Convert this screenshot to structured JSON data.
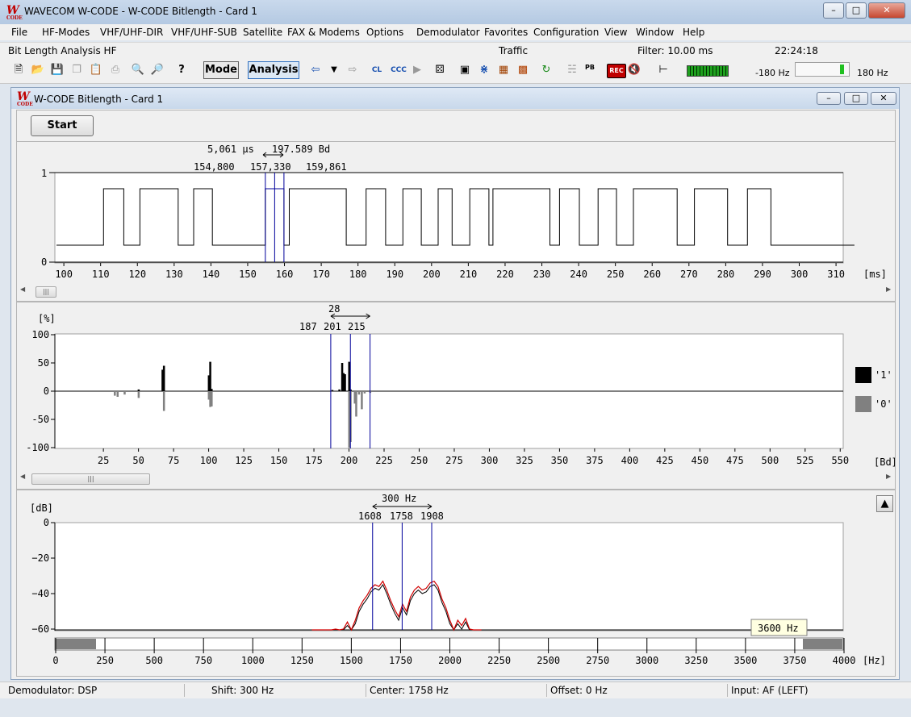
{
  "window": {
    "title": "WAVECOM W-CODE - W-CODE Bitlength  - Card 1"
  },
  "menu": [
    "File",
    "HF-Modes",
    "VHF/UHF-DIR",
    "VHF/UHF-SUB",
    "Satellite",
    "FAX & Modems",
    "Options",
    "Demodulator",
    "Favorites",
    "Configuration",
    "View",
    "Window",
    "Help"
  ],
  "statusline": {
    "mode": "Bit Length Analysis HF",
    "traffic": "Traffic",
    "filter": "Filter: 10.00 ms",
    "time": "22:24:18"
  },
  "toolbar": {
    "mode_label": "Mode",
    "analysis_label": "Analysis",
    "cl_label": "CL",
    "ccc_label": "CCC",
    "pb_label": "PB",
    "rec_label": "REC",
    "freq_min": "-180 Hz",
    "freq_max": "180 Hz"
  },
  "child": {
    "title": "W-CODE Bitlength  - Card 1",
    "start_label": "Start"
  },
  "timing": {
    "unit": "[ms]",
    "cursor_width": "5,061 µs",
    "cursor_rate": "197.589 Bd",
    "cursor_left": "154,800",
    "cursor_center": "157,330",
    "cursor_right": "159,861",
    "y_ticks": [
      "1",
      "0"
    ],
    "x_ticks": [
      "100",
      "110",
      "120",
      "130",
      "140",
      "150",
      "160",
      "170",
      "180",
      "190",
      "200",
      "210",
      "220",
      "230",
      "240",
      "250",
      "260",
      "270",
      "280",
      "290",
      "300",
      "310"
    ],
    "bits": [
      [
        98,
        0
      ],
      [
        110.8,
        1
      ],
      [
        116.3,
        0
      ],
      [
        120.7,
        1
      ],
      [
        131.1,
        0
      ],
      [
        135.3,
        1
      ],
      [
        140.4,
        0
      ],
      [
        154.8,
        1
      ],
      [
        159.86,
        0
      ],
      [
        161.3,
        1
      ],
      [
        176.8,
        0
      ],
      [
        182.2,
        1
      ],
      [
        187.5,
        0
      ],
      [
        192.2,
        1
      ],
      [
        197.2,
        0
      ],
      [
        201.8,
        1
      ],
      [
        205.6,
        0
      ],
      [
        210.4,
        1
      ],
      [
        215.6,
        0
      ],
      [
        216.7,
        1
      ],
      [
        232.2,
        0
      ],
      [
        234.8,
        1
      ],
      [
        240.2,
        0
      ],
      [
        245.3,
        1
      ],
      [
        250.3,
        0
      ],
      [
        254.9,
        1
      ],
      [
        266.8,
        0
      ],
      [
        271.5,
        1
      ],
      [
        280.5,
        0
      ],
      [
        285.9,
        1
      ],
      [
        292.3,
        0
      ],
      [
        315,
        0
      ]
    ]
  },
  "histogram": {
    "unit_y": "[%]",
    "unit_x": "[Bd]",
    "span": "28",
    "cursor_left": "187",
    "cursor_center": "201",
    "cursor_right": "215",
    "y_ticks": [
      "100",
      "50",
      "0",
      "-50",
      "-100"
    ],
    "x_ticks": [
      "25",
      "50",
      "75",
      "100",
      "125",
      "150",
      "175",
      "200",
      "225",
      "250",
      "275",
      "300",
      "325",
      "350",
      "375",
      "400",
      "425",
      "450",
      "475",
      "500",
      "525",
      "550"
    ],
    "legend_one": "'1'",
    "legend_zero": "'0'",
    "ones": [
      [
        50,
        3
      ],
      [
        67,
        38
      ],
      [
        68,
        45
      ],
      [
        100,
        28
      ],
      [
        101,
        52
      ],
      [
        102,
        4
      ],
      [
        188,
        2
      ],
      [
        193,
        3
      ],
      [
        195,
        50
      ],
      [
        196,
        32
      ],
      [
        197,
        30
      ],
      [
        200,
        52
      ],
      [
        201,
        3
      ]
    ],
    "zeros": [
      [
        33,
        -8
      ],
      [
        35,
        -10
      ],
      [
        40,
        -6
      ],
      [
        50,
        -12
      ],
      [
        68,
        -35
      ],
      [
        100,
        -15
      ],
      [
        101,
        -28
      ],
      [
        102,
        -27
      ],
      [
        200,
        -100
      ],
      [
        201,
        -90
      ],
      [
        204,
        -22
      ],
      [
        205,
        -45
      ],
      [
        207,
        -6
      ],
      [
        209,
        -32
      ],
      [
        211,
        -4
      ],
      [
        215,
        -3
      ]
    ]
  },
  "spectrum": {
    "unit_y": "[dB]",
    "unit_x": "[Hz]",
    "span": "300 Hz",
    "cursor_left": "1608",
    "cursor_center": "1758",
    "cursor_right": "1908",
    "y_ticks": [
      "0",
      "−20",
      "−40",
      "−60"
    ],
    "x_ticks": [
      "0",
      "250",
      "500",
      "750",
      "1000",
      "1250",
      "1500",
      "1750",
      "2000",
      "2250",
      "2500",
      "2750",
      "3000",
      "3250",
      "3500",
      "3750",
      "4000"
    ],
    "bandwidth_label": "3600 Hz",
    "trace": [
      [
        1300,
        -64
      ],
      [
        1360,
        -63
      ],
      [
        1400,
        -62
      ],
      [
        1420,
        -60
      ],
      [
        1440,
        -63
      ],
      [
        1460,
        -60
      ],
      [
        1480,
        -56
      ],
      [
        1500,
        -62
      ],
      [
        1520,
        -55
      ],
      [
        1540,
        -48
      ],
      [
        1560,
        -44
      ],
      [
        1580,
        -41
      ],
      [
        1600,
        -37
      ],
      [
        1620,
        -35
      ],
      [
        1640,
        -36
      ],
      [
        1660,
        -33
      ],
      [
        1680,
        -38
      ],
      [
        1700,
        -44
      ],
      [
        1720,
        -49
      ],
      [
        1740,
        -53
      ],
      [
        1760,
        -46
      ],
      [
        1780,
        -50
      ],
      [
        1800,
        -42
      ],
      [
        1820,
        -38
      ],
      [
        1840,
        -36
      ],
      [
        1860,
        -38
      ],
      [
        1880,
        -37
      ],
      [
        1900,
        -34
      ],
      [
        1920,
        -33
      ],
      [
        1940,
        -36
      ],
      [
        1960,
        -43
      ],
      [
        1980,
        -48
      ],
      [
        2000,
        -55
      ],
      [
        2020,
        -61
      ],
      [
        2040,
        -55
      ],
      [
        2060,
        -58
      ],
      [
        2080,
        -54
      ],
      [
        2100,
        -60
      ],
      [
        2120,
        -63
      ],
      [
        2160,
        -64
      ]
    ]
  },
  "statusbar": {
    "demod": "Demodulator: DSP",
    "shift": "Shift: 300 Hz",
    "center": "Center: 1758 Hz",
    "offset": "Offset: 0 Hz",
    "input": "Input: AF (LEFT)"
  },
  "colors": {
    "cursor": "#00009a",
    "trace_red": "#d00000",
    "trace_black": "#000000",
    "zero_bar": "#808080"
  }
}
